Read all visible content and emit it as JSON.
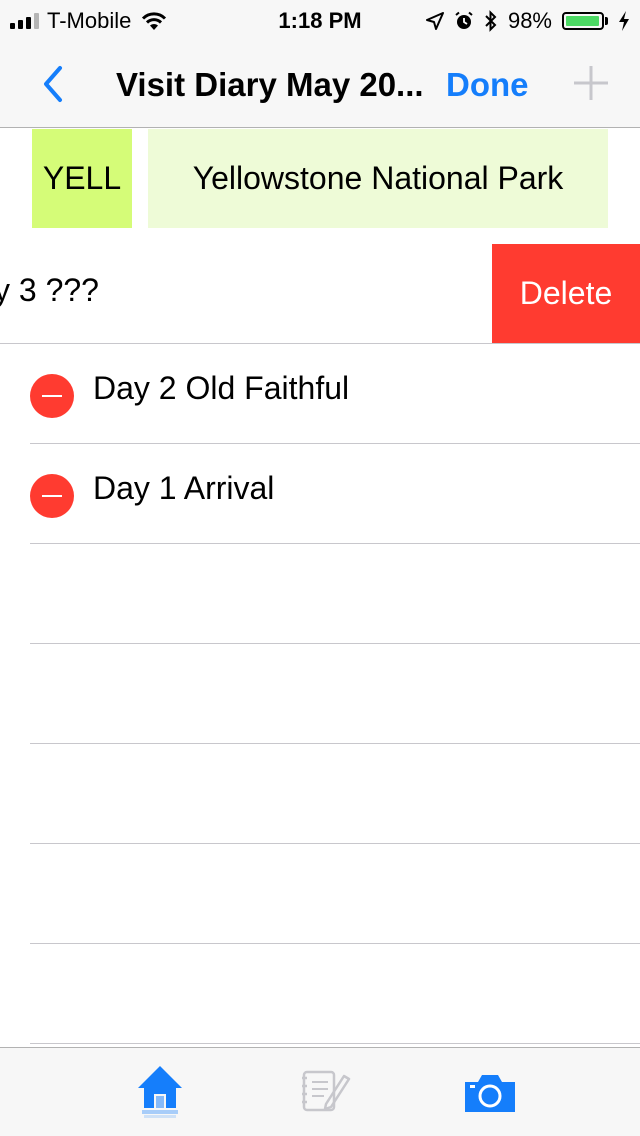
{
  "status_bar": {
    "carrier": "T-Mobile",
    "time": "1:18 PM",
    "battery_percent": "98%",
    "battery_level": 0.98,
    "battery_color": "#4cd964"
  },
  "nav_bar": {
    "title": "Visit Diary May 20...",
    "done_label": "Done",
    "back_icon": "chevron-left-icon",
    "add_icon": "plus-icon",
    "accent_color": "#157efb"
  },
  "park": {
    "code": "YELL",
    "name": "Yellowstone National Park"
  },
  "entries": [
    {
      "label": "y 3 ???",
      "state": "swiped",
      "action_label": "Delete"
    },
    {
      "label": "Day 2 Old Faithful",
      "state": "editing"
    },
    {
      "label": "Day 1 Arrival",
      "state": "editing"
    }
  ],
  "tab_bar": {
    "tabs": [
      {
        "icon": "home-icon",
        "active": true
      },
      {
        "icon": "notebook-pencil-icon",
        "active": false
      },
      {
        "icon": "camera-icon",
        "active": true
      }
    ]
  },
  "colors": {
    "delete_red": "#ff3b30",
    "park_code_bg": "#d5fc78",
    "park_name_bg": "#eefbd7"
  }
}
